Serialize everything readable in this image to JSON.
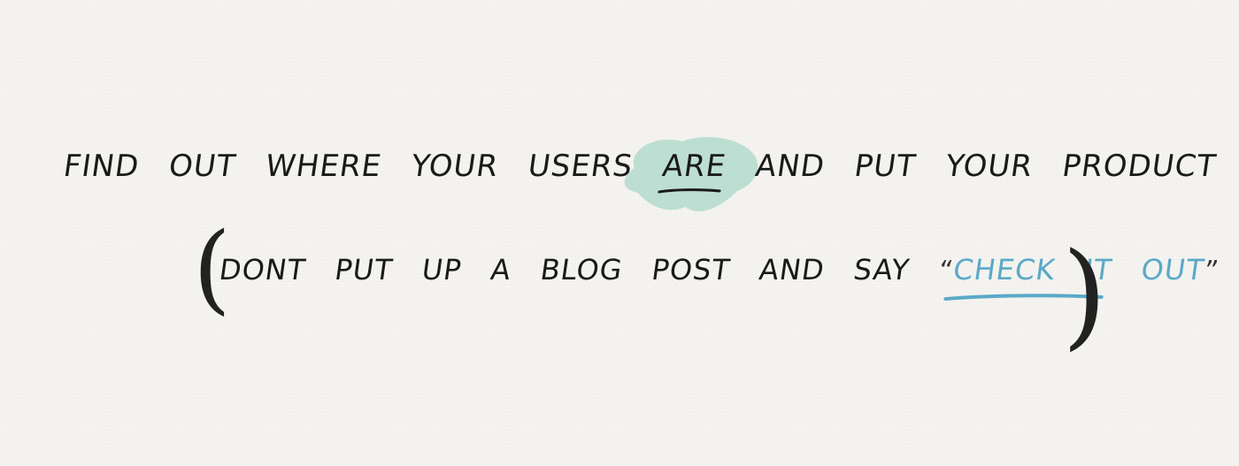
{
  "sketch": {
    "line1": {
      "part1": "Find out where your users",
      "emphasis": "ARE",
      "part2": "and put your product there"
    },
    "line2": {
      "open_paren": "(",
      "part1": "Dont put up a blog post and say",
      "quote_open": "“",
      "emphasis": "check it out",
      "quote_close": "”",
      "close_paren": ")"
    },
    "colors": {
      "ink": "#1a1a1a",
      "highlight": "#9fd3c3",
      "accent": "#5aa9c8",
      "paper": "#f4f3ef"
    }
  }
}
